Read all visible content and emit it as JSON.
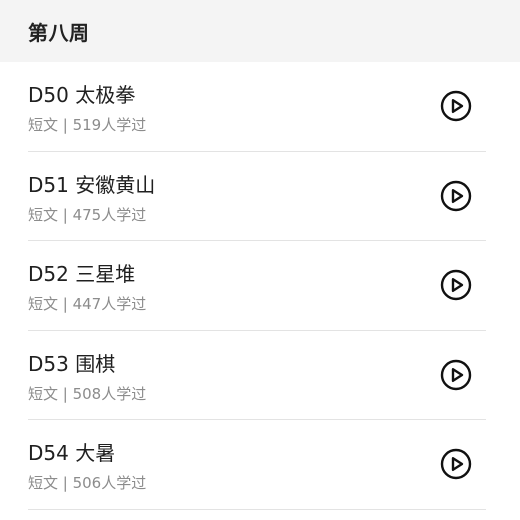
{
  "header": {
    "title": "第八周"
  },
  "lessons": [
    {
      "title": "D50 太极拳",
      "meta": "短文 | 519人学过",
      "icon": "play-circle-icon"
    },
    {
      "title": "D51 安徽黄山",
      "meta": "短文 | 475人学过",
      "icon": "play-circle-icon"
    },
    {
      "title": "D52 三星堆",
      "meta": "短文 | 447人学过",
      "icon": "play-circle-icon"
    },
    {
      "title": "D53 围棋",
      "meta": "短文 | 508人学过",
      "icon": "play-circle-icon"
    },
    {
      "title": "D54 大暑",
      "meta": "短文 | 506人学过",
      "icon": "play-circle-icon"
    }
  ],
  "colors": {
    "header_background": "#f4f4f4",
    "title_text": "#202020",
    "meta_text": "#8c8c8c",
    "divider": "#e3e3e3",
    "icon": "#111111"
  }
}
